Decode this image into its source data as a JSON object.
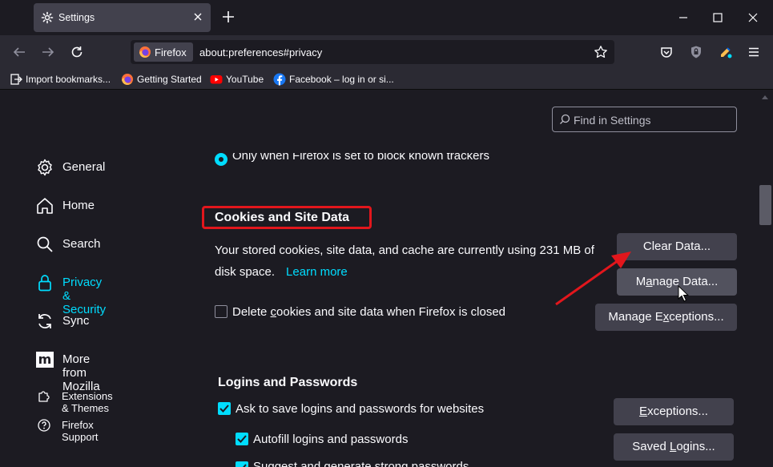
{
  "tab": {
    "title": "Settings"
  },
  "urlbar": {
    "identity_label": "Firefox",
    "url": "about:preferences#privacy"
  },
  "bookmarks": [
    {
      "label": "Import bookmarks...",
      "icon": "import-icon"
    },
    {
      "label": "Getting Started",
      "icon": "firefox-icon"
    },
    {
      "label": "YouTube",
      "icon": "youtube-icon"
    },
    {
      "label": "Facebook – log in or si...",
      "icon": "facebook-icon"
    }
  ],
  "search": {
    "placeholder": "Find in Settings"
  },
  "sidebar": {
    "items": [
      {
        "label": "General",
        "icon": "gear-icon"
      },
      {
        "label": "Home",
        "icon": "home-icon"
      },
      {
        "label": "Search",
        "icon": "search-icon"
      },
      {
        "label": "Privacy & Security",
        "icon": "lock-icon",
        "selected": true
      },
      {
        "label": "Sync",
        "icon": "sync-icon"
      },
      {
        "label": "More from Mozilla",
        "icon": "mozilla-icon"
      }
    ],
    "footer": [
      {
        "label": "Extensions & Themes",
        "icon": "puzzle-icon"
      },
      {
        "label": "Firefox Support",
        "icon": "help-icon"
      }
    ]
  },
  "tracking": {
    "partial_option": "Only when Firefox is set to block known trackers"
  },
  "cookies": {
    "heading": "Cookies and Site Data",
    "usage_text": "Your stored cookies, site data, and cache are currently using 231 MB of disk space.",
    "learn_more": "Learn more",
    "clear_button": "Clear Data...",
    "manage_button_pre": "M",
    "manage_button_u": "a",
    "manage_button_post": "nage Data...",
    "exceptions_button_pre": "Manage E",
    "exceptions_button_u": "x",
    "exceptions_button_post": "ceptions...",
    "delete_label_pre": "Delete ",
    "delete_label_u": "c",
    "delete_label_post": "ookies and site data when Firefox is closed",
    "delete_checked": false
  },
  "logins": {
    "heading": "Logins and Passwords",
    "ask_label": "Ask to save logins and passwords for websites",
    "ask_checked": true,
    "autofill_label": "Autofill logins and passwords",
    "autofill_checked": true,
    "suggest_label": "Suggest and generate strong passwords",
    "suggest_checked": true,
    "exceptions_button_u": "E",
    "exceptions_button_post": "xceptions...",
    "saved_button_pre": "Saved ",
    "saved_button_u": "L",
    "saved_button_post": "ogins..."
  },
  "colors": {
    "accent": "#00ddff",
    "highlight": "#e2161c",
    "background": "#1c1b22"
  }
}
